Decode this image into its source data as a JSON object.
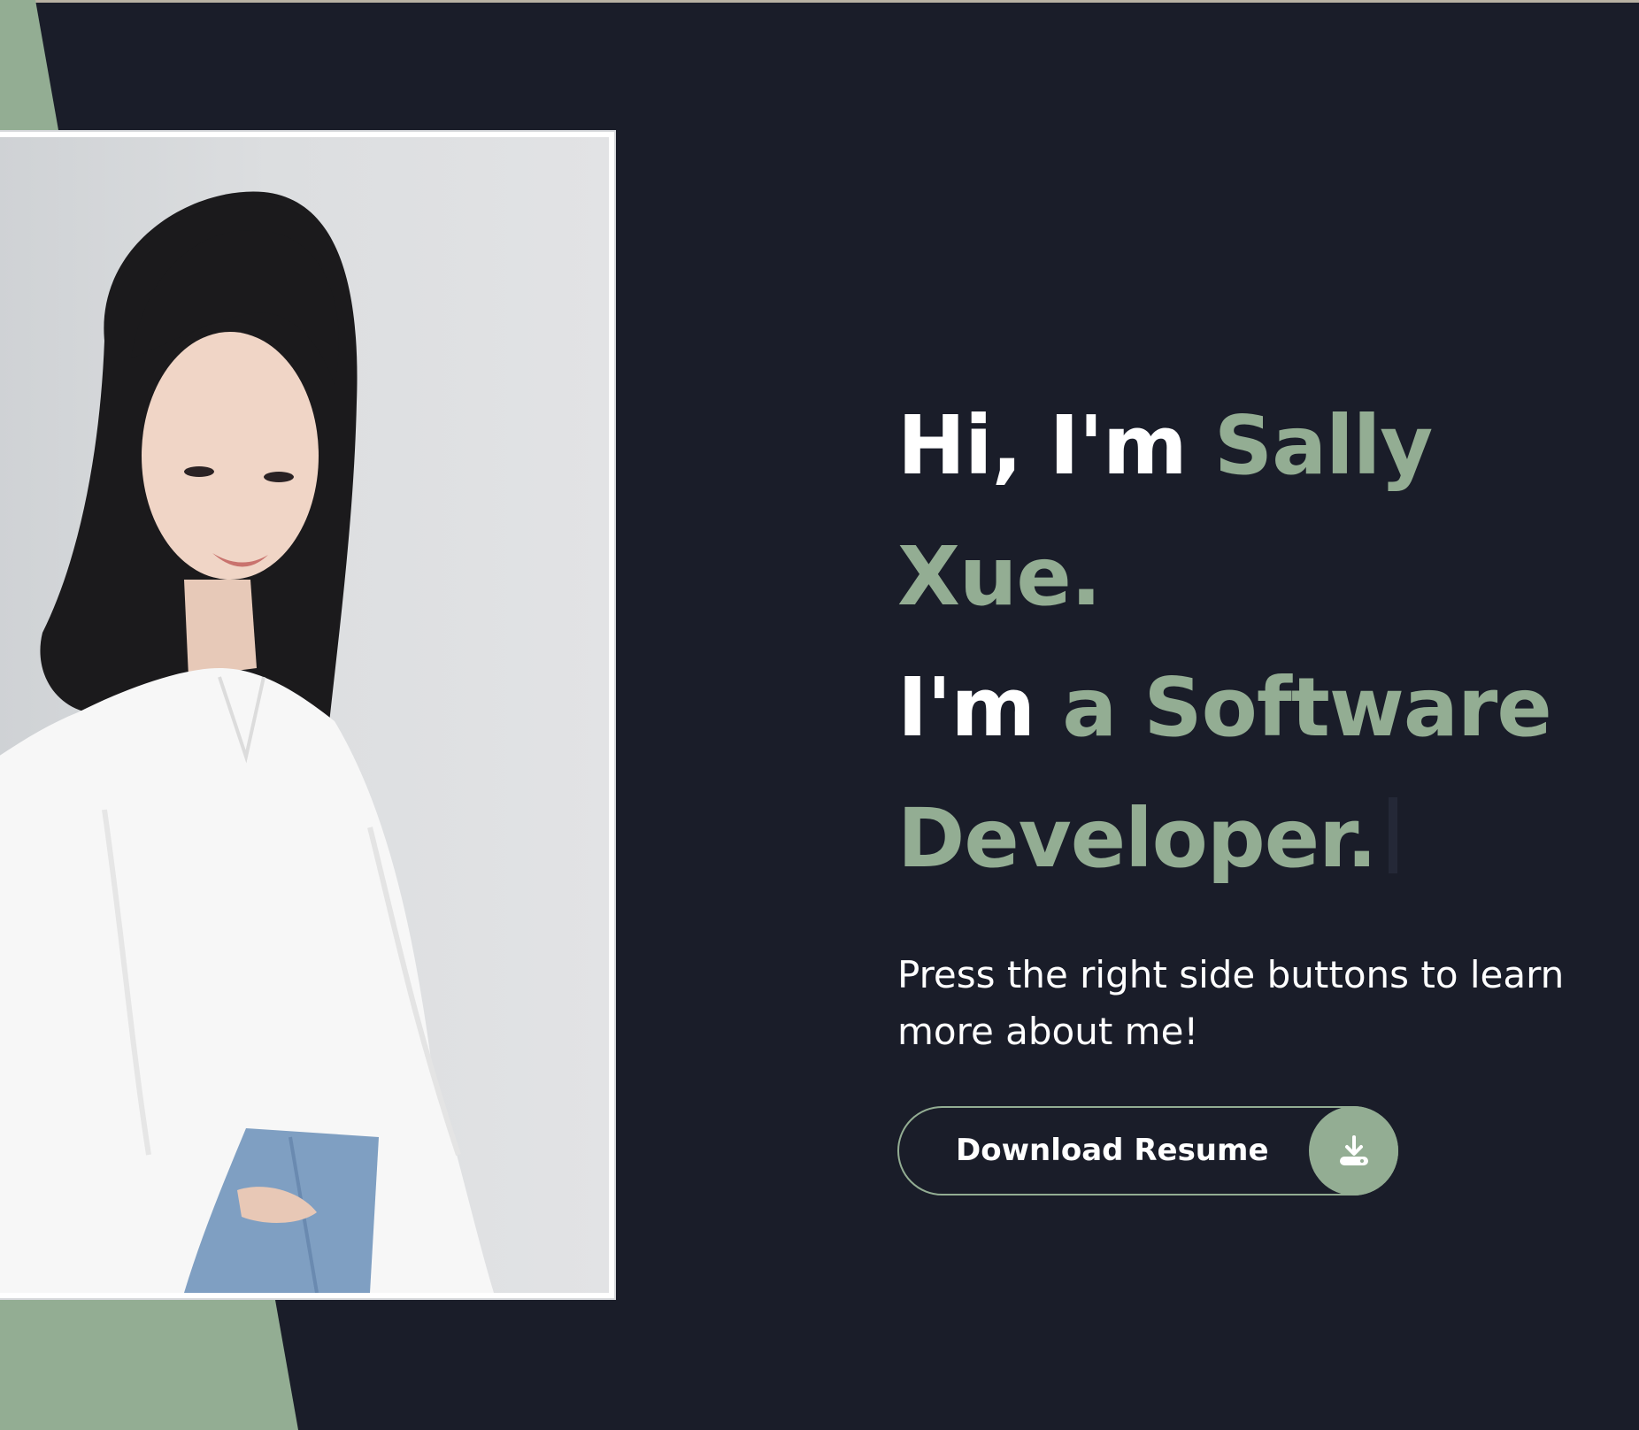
{
  "hero": {
    "greeting_prefix": "Hi, I'm ",
    "name": "Sally Xue.",
    "role_prefix": "I'm ",
    "role": "a Software Developer.",
    "subtitle": "Press the right side buttons to learn more about me!",
    "download_label": "Download Resume"
  },
  "icons": {
    "download": "download-icon"
  },
  "colors": {
    "background": "#1a1d29",
    "accent": "#93ad93",
    "text": "#ffffff"
  }
}
